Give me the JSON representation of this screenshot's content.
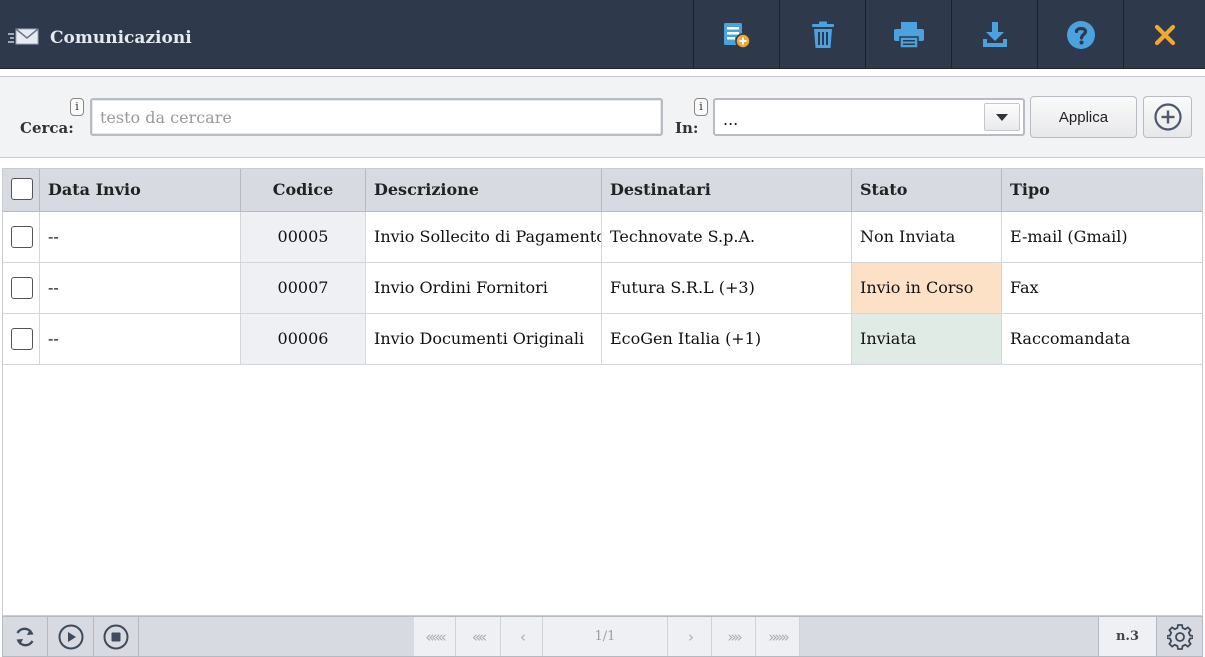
{
  "window": {
    "title": "Comunicazioni",
    "icon": "mail-send-icon",
    "toolbar": [
      {
        "name": "new-document-button",
        "icon": "new-document-icon"
      },
      {
        "name": "delete-button",
        "icon": "trash-icon"
      },
      {
        "name": "print-button",
        "icon": "printer-icon"
      },
      {
        "name": "download-button",
        "icon": "download-icon"
      },
      {
        "name": "help-button",
        "icon": "help-icon"
      },
      {
        "name": "close-button",
        "icon": "close-icon"
      }
    ],
    "colors": {
      "titlebar": "#2e3a4c",
      "toolbar_icon": "#4aa3df",
      "close_icon": "#f0a830"
    }
  },
  "search": {
    "label": "Cerca:",
    "info": "i",
    "placeholder": "testo da cercare",
    "value": "",
    "in_label": "In:",
    "in_info": "i",
    "in_value": "...",
    "apply_label": "Applica"
  },
  "table": {
    "columns": [
      "Data Invio",
      "Codice",
      "Descrizione",
      "Destinatari",
      "Stato",
      "Tipo"
    ],
    "rows": [
      {
        "data_invio": "--",
        "codice": "00005",
        "descrizione": "Invio Sollecito di Pagamento",
        "destinatari": "Technovate S.p.A.",
        "stato": "Non Inviata",
        "tipo": "E-mail (Gmail)"
      },
      {
        "data_invio": "--",
        "codice": "00007",
        "descrizione": "Invio Ordini Fornitori",
        "destinatari": "Futura S.R.L (+3)",
        "stato": "Invio in Corso",
        "tipo": "Fax"
      },
      {
        "data_invio": "--",
        "codice": "00006",
        "descrizione": "Invio Documenti Originali",
        "destinatari": "EcoGen Italia (+1)",
        "stato": "Inviata",
        "tipo": "Raccomandata"
      }
    ],
    "status_colors": {
      "Invio in Corso": "#fde1c7",
      "Inviata": "#e1ebe6",
      "Non Inviata": "#ffffff"
    }
  },
  "footer": {
    "first": "«««",
    "prev_page": "««",
    "prev": "‹",
    "page": "1/1",
    "next": "›",
    "next_page": "»»",
    "last": "»»»",
    "count": "n.3"
  }
}
